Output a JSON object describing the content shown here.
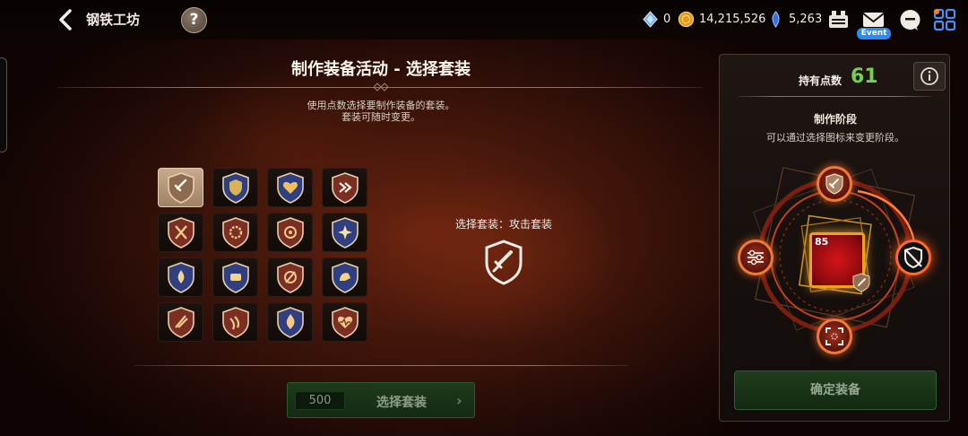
{
  "header": {
    "title": "钢铁工坊",
    "help_symbol": "?",
    "currencies": [
      {
        "icon": "crystal-icon",
        "value": "0"
      },
      {
        "icon": "gold-coin-icon",
        "value": "14,215,526"
      },
      {
        "icon": "blue-gem-icon",
        "value": "5,263"
      }
    ],
    "event_badge": "Event"
  },
  "main": {
    "title": "制作装备活动 - 选择套装",
    "description_line1": "使用点数选择要制作装备的套装。",
    "description_line2": "套装可随时变更。",
    "set_icons": [
      [
        "sword-shield-icon",
        "crest-shield-icon",
        "heart-shield-icon",
        "arrow-shield-icon"
      ],
      [
        "crossed-swords-icon",
        "sun-shield-icon",
        "target-shield-icon",
        "star-shield-icon"
      ],
      [
        "drop-shield-icon",
        "gauntlet-shield-icon",
        "slash-shield-icon",
        "arm-shield-icon"
      ],
      [
        "blade-shield-icon",
        "claw-shield-icon",
        "flame-shield-icon",
        "heartbeat-shield-icon"
      ]
    ],
    "selected_index": 0,
    "selected_label": "选择套装：攻击套装",
    "cost_value": "500",
    "cost_button_label": "选择套装",
    "cost_arrow": "›"
  },
  "side": {
    "points_label": "持有点数",
    "points_value": "61",
    "stage_title": "制作阶段",
    "stage_desc": "可以通过选择图标来变更阶段。",
    "equip_level": "85",
    "stage_nodes": [
      "sword-node-icon",
      "no-shield-node-icon",
      "focus-node-icon",
      "sliders-node-icon"
    ],
    "confirm_label": "确定装备"
  },
  "colors": {
    "accent_green": "#74d24a",
    "node_glow": "#f07a3a",
    "equip_red": "#d4141a",
    "equip_frame": "#f0a01f"
  }
}
